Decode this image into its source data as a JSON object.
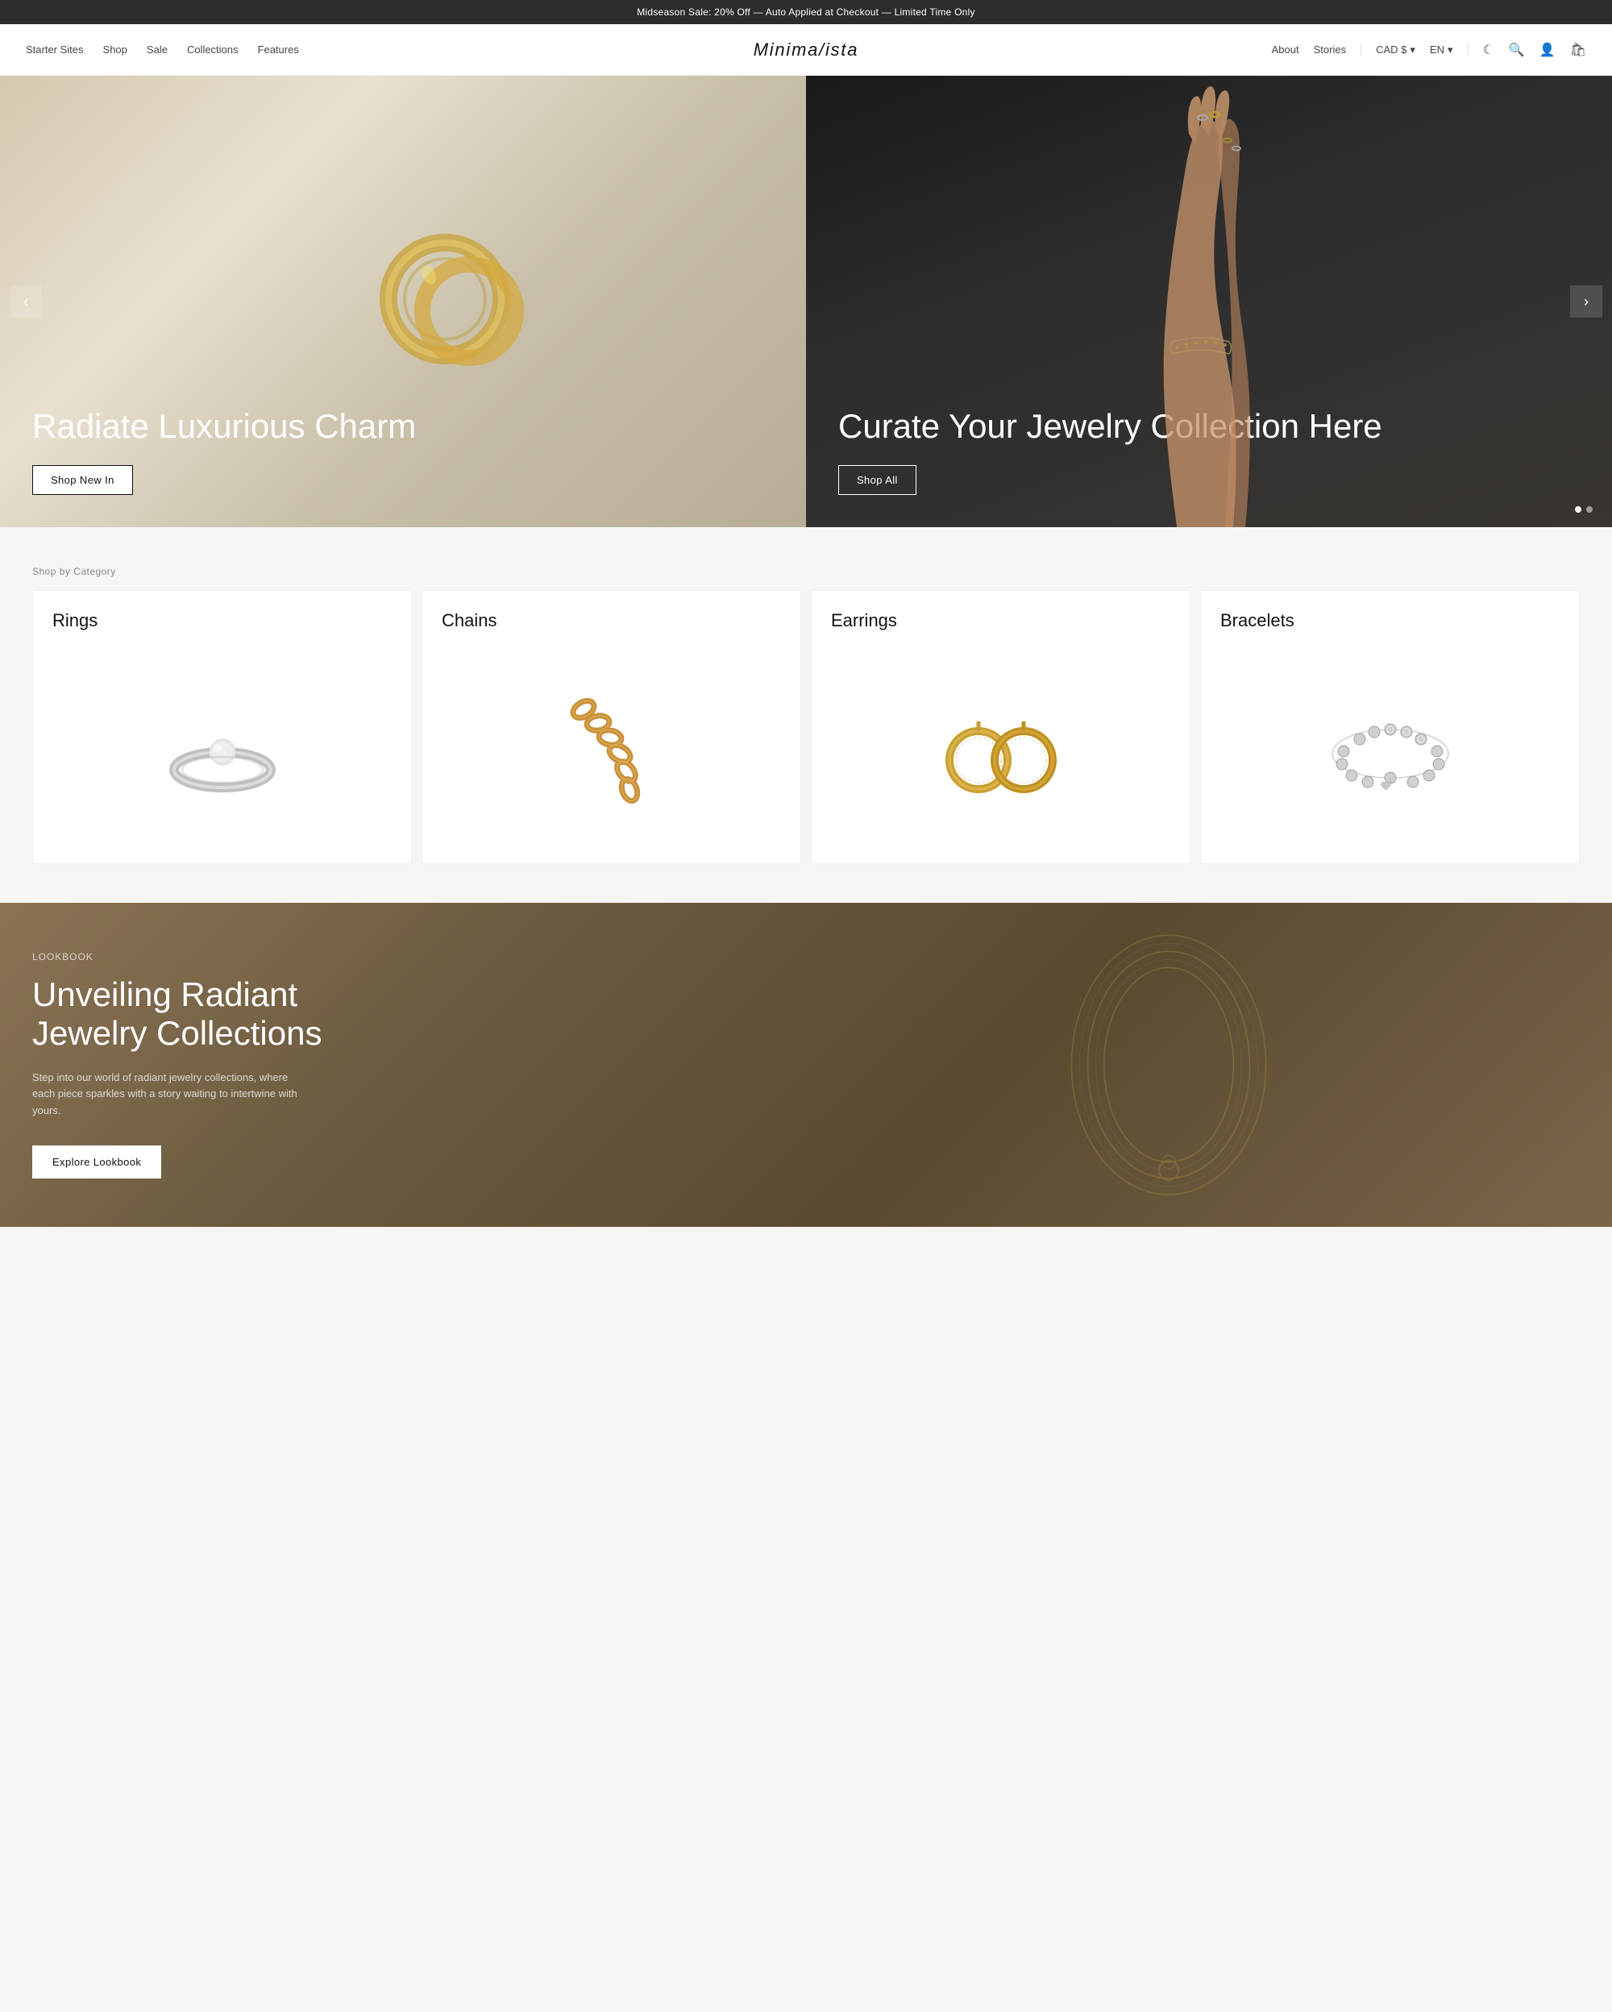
{
  "announcement": {
    "text": "Midseason Sale: 20% Off — Auto Applied at Checkout — Limited Time Only"
  },
  "nav": {
    "left_items": [
      "Starter Sites",
      "Shop",
      "Sale",
      "Collections",
      "Features"
    ],
    "logo": "Minima/ista",
    "right_items": [
      "About",
      "Stories"
    ],
    "currency": "CAD $",
    "language": "EN"
  },
  "hero": {
    "left": {
      "heading": "Radiate Luxurious Charm",
      "button_label": "Shop New In"
    },
    "right": {
      "heading": "Curate Your Jewelry Collection Here",
      "button_label": "Shop All"
    },
    "prev_label": "‹",
    "next_label": "›"
  },
  "categories": {
    "section_label": "Shop by Category",
    "items": [
      {
        "name": "Rings",
        "id": "rings"
      },
      {
        "name": "Chains",
        "id": "chains"
      },
      {
        "name": "Earrings",
        "id": "earrings"
      },
      {
        "name": "Bracelets",
        "id": "bracelets"
      }
    ]
  },
  "lookbook": {
    "label": "Lookbook",
    "heading": "Unveiling Radiant Jewelry Collections",
    "description": "Step into our world of radiant jewelry collections, where each piece sparkles with a story waiting to intertwine with yours.",
    "button_label": "Explore Lookbook"
  }
}
